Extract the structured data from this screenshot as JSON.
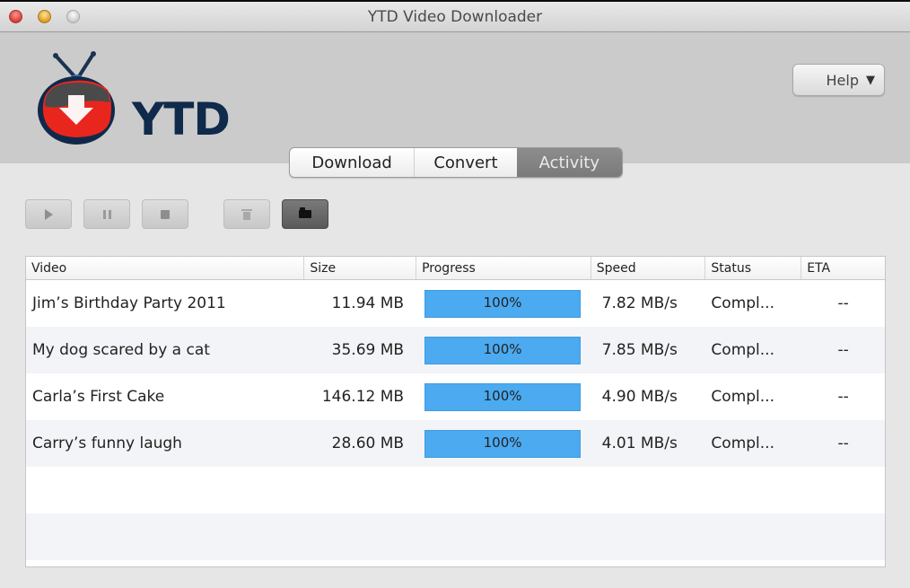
{
  "window": {
    "title": "YTD Video Downloader"
  },
  "header": {
    "logo_text": "YTD",
    "help_label": "Help",
    "help_caret": "▼"
  },
  "tabs": [
    {
      "label": "Download",
      "active": false
    },
    {
      "label": "Convert",
      "active": false
    },
    {
      "label": "Activity",
      "active": true
    }
  ],
  "toolbar": [
    {
      "name": "play",
      "icon": "play-icon",
      "enabled": false
    },
    {
      "name": "pause",
      "icon": "pause-icon",
      "enabled": false
    },
    {
      "name": "stop",
      "icon": "stop-icon",
      "enabled": false
    },
    {
      "name": "delete",
      "icon": "trash-icon",
      "enabled": false
    },
    {
      "name": "open-folder",
      "icon": "folder-icon",
      "enabled": true
    }
  ],
  "table": {
    "columns": [
      "Video",
      "Size",
      "Progress",
      "Speed",
      "Status",
      "ETA"
    ],
    "rows": [
      {
        "video": "Jim’s Birthday Party 2011",
        "size": "11.94 MB",
        "progress": 100,
        "progress_label": "100%",
        "speed": "7.82 MB/s",
        "status": "Compl...",
        "eta": "--"
      },
      {
        "video": "My dog scared by a cat",
        "size": "35.69 MB",
        "progress": 100,
        "progress_label": "100%",
        "speed": "7.85 MB/s",
        "status": "Compl...",
        "eta": "--"
      },
      {
        "video": "Carla’s First Cake",
        "size": "146.12 MB",
        "progress": 100,
        "progress_label": "100%",
        "speed": "4.90 MB/s",
        "status": "Compl...",
        "eta": "--"
      },
      {
        "video": "Carry’s funny laugh",
        "size": "28.60 MB",
        "progress": 100,
        "progress_label": "100%",
        "speed": "4.01 MB/s",
        "status": "Compl...",
        "eta": "--"
      }
    ],
    "empty_rows": 2
  },
  "colors": {
    "progress_fill": "#4baaf0",
    "active_tab": "#808080",
    "logo_red": "#e8261d",
    "logo_navy": "#0f2a4a"
  }
}
